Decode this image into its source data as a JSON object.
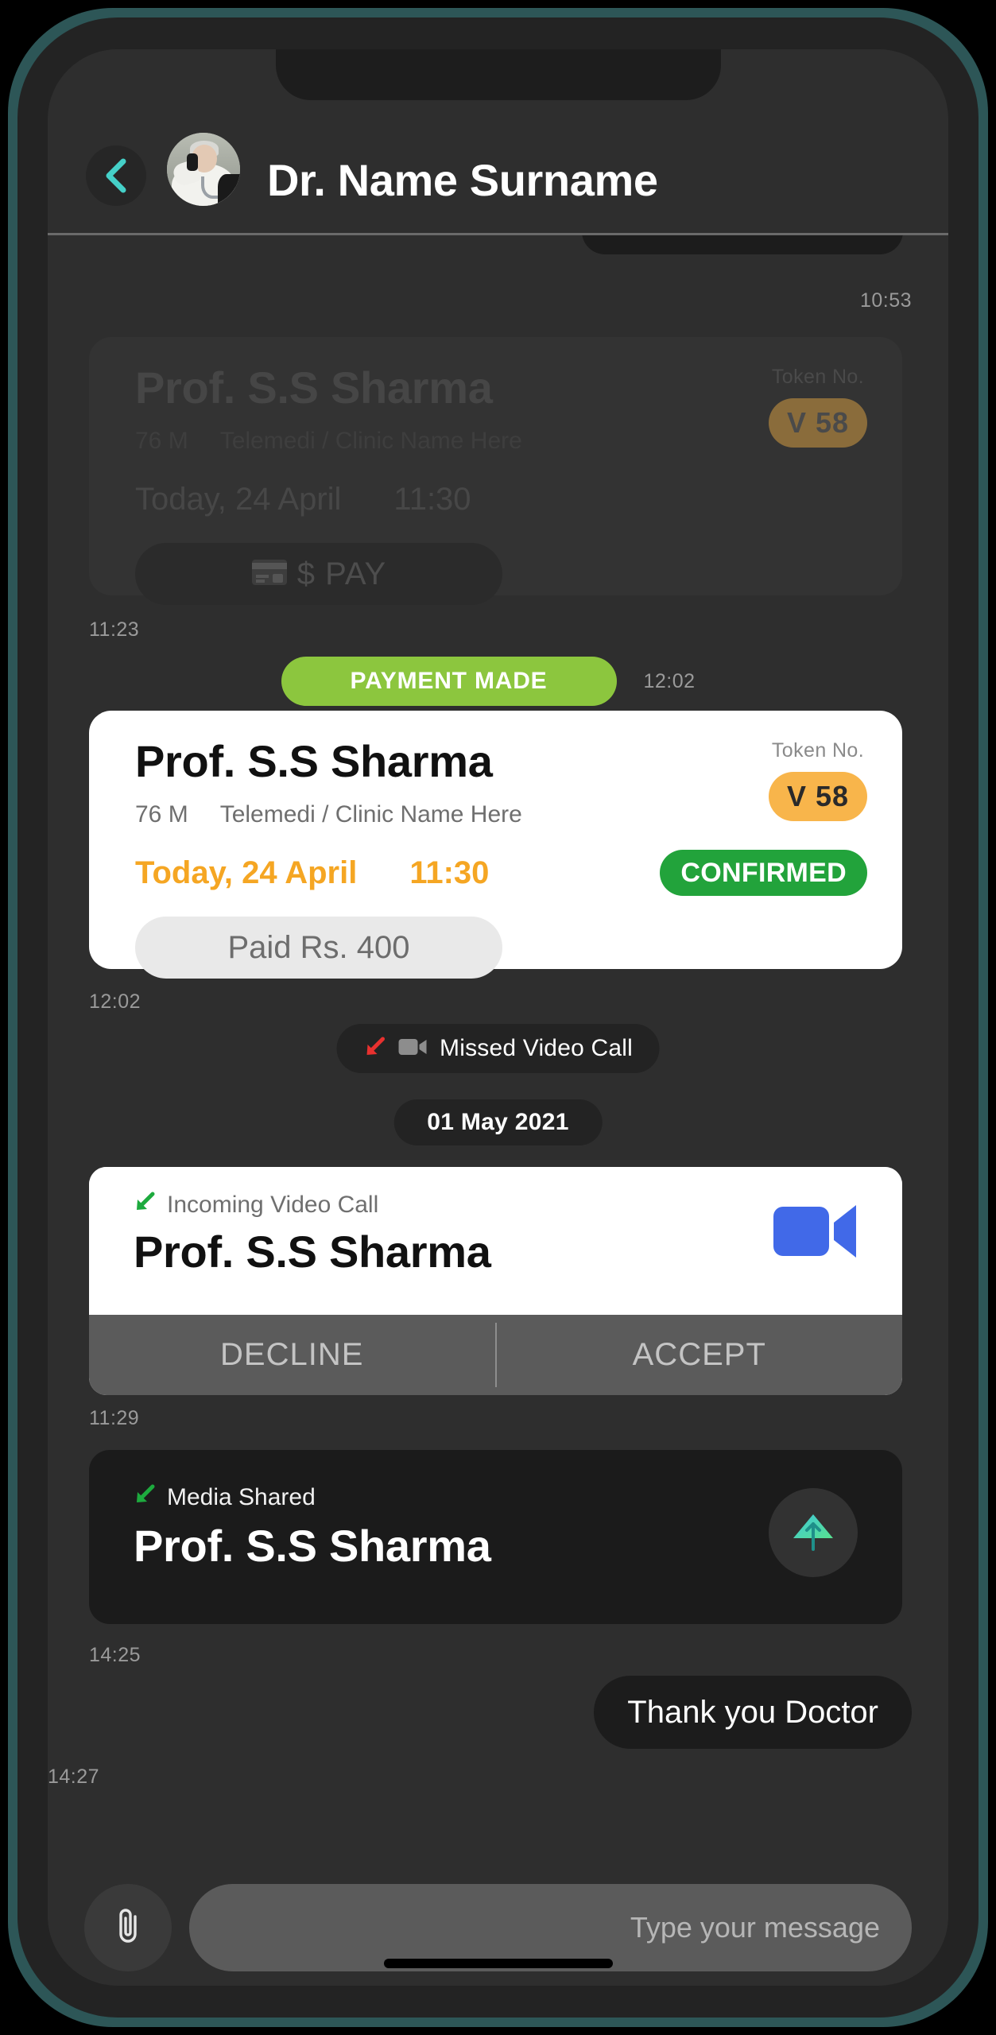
{
  "header": {
    "title": "Dr. Name Surname",
    "back_icon": "chevron-left-icon",
    "avatar_alt": "doctor-avatar"
  },
  "conversation": {
    "top_timestamp": "10:53",
    "pending_card": {
      "doctor_name": "Prof. S.S Sharma",
      "age_sex": "76 M",
      "clinic": "Telemedi / Clinic Name Here",
      "date": "Today, 24 April",
      "time": "11:30",
      "token_label": "Token No.",
      "token_value": "V 58",
      "pay_label": "$ PAY",
      "pay_icon": "credit-card-icon",
      "timestamp": "11:23"
    },
    "payment_made": {
      "label": "PAYMENT MADE",
      "timestamp": "12:02"
    },
    "confirmed_card": {
      "doctor_name": "Prof. S.S Sharma",
      "age_sex": "76 M",
      "clinic": "Telemedi / Clinic Name Here",
      "date": "Today, 24 April",
      "time": "11:30",
      "token_label": "Token No.",
      "token_value": "V 58",
      "status": "CONFIRMED",
      "paid_label": "Paid Rs. 400",
      "timestamp": "12:02"
    },
    "missed_call": {
      "label": "Missed Video Call",
      "arrow_icon": "arrow-down-left-icon",
      "camera_icon": "video-camera-icon"
    },
    "date_divider": "01 May 2021",
    "incoming_call": {
      "tag": "Incoming Video Call",
      "arrow_icon": "arrow-down-left-icon",
      "doctor_name": "Prof. S.S Sharma",
      "video_icon": "video-camera-icon",
      "decline_label": "DECLINE",
      "accept_label": "ACCEPT",
      "timestamp": "11:29"
    },
    "media_shared": {
      "tag": "Media Shared",
      "arrow_icon": "arrow-down-left-icon",
      "doctor_name": "Prof. S.S Sharma",
      "upload_icon": "cloud-upload-icon",
      "timestamp": "14:25"
    },
    "outgoing_message": {
      "text": "Thank you Doctor",
      "timestamp": "14:27"
    }
  },
  "composer": {
    "attach_icon": "paperclip-icon",
    "input_value": "",
    "placeholder": "Type your message"
  },
  "colors": {
    "accent_teal": "#45D0C8",
    "token_orange": "#F8B54B",
    "date_orange": "#F5A623",
    "payment_green": "#8CC63E",
    "confirmed_green": "#22A33B",
    "incoming_green": "#1DAA3E",
    "missed_red": "#E8312F",
    "video_blue": "#4169E8",
    "screen_bg": "#2E2E2E",
    "frame_bg": "#232323",
    "glow_teal": "#2F5B5C"
  }
}
